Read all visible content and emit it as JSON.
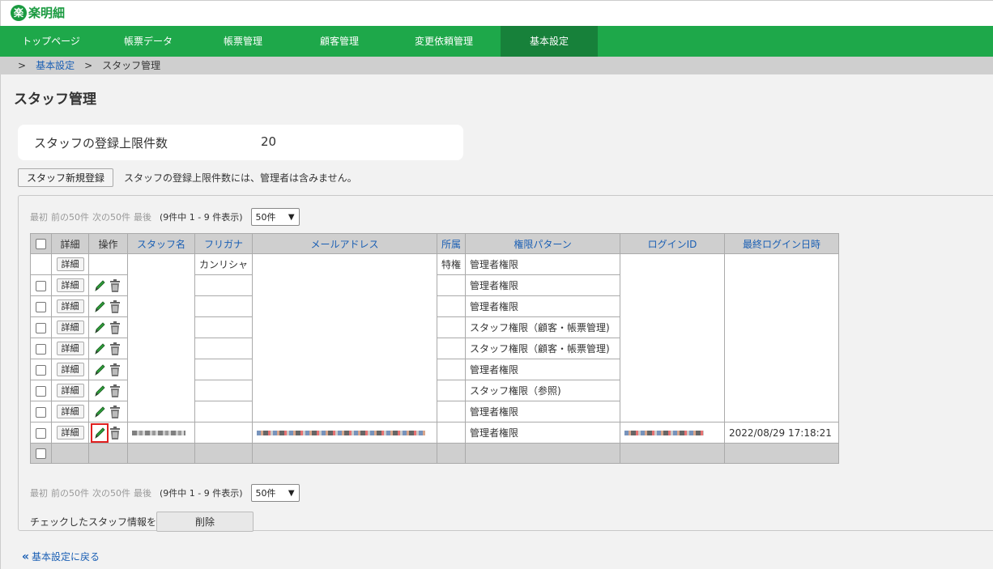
{
  "header": {
    "logo_badge": "楽",
    "logo_text": "楽明細"
  },
  "nav": [
    {
      "label": "トップページ",
      "active": false
    },
    {
      "label": "帳票データ",
      "active": false
    },
    {
      "label": "帳票管理",
      "active": false
    },
    {
      "label": "顧客管理",
      "active": false
    },
    {
      "label": "変更依頼管理",
      "active": false
    },
    {
      "label": "基本設定",
      "active": true
    }
  ],
  "breadcrumb": {
    "sep1": ">",
    "parent": "基本設定",
    "sep2": ">",
    "current": "スタッフ管理"
  },
  "page_title": "スタッフ管理",
  "limit": {
    "label": "スタッフの登録上限件数",
    "value": "20"
  },
  "new_button": "スタッフ新規登録",
  "new_note": "スタッフの登録上限件数には、管理者は含みません。",
  "pager": {
    "first": "最初",
    "prev": "前の50件",
    "next": "次の50件",
    "last": "最後",
    "count": "(9件中 1 - 9 件表示)",
    "per_page": "50件"
  },
  "table": {
    "headers": {
      "detail": "詳細",
      "ops": "操作",
      "name": "スタッフ名",
      "kana": "フリガナ",
      "email": "メールアドレス",
      "dept": "所属",
      "role": "権限パターン",
      "login_id": "ログインID",
      "last_login": "最終ログイン日時"
    },
    "detail_label": "詳細",
    "rows": [
      {
        "kana": "カンリシャ",
        "dept": "特権",
        "role": "管理者権限",
        "last_login": ""
      },
      {
        "kana": "",
        "dept": "",
        "role": "管理者権限",
        "last_login": ""
      },
      {
        "kana": "",
        "dept": "",
        "role": "管理者権限",
        "last_login": ""
      },
      {
        "kana": "",
        "dept": "",
        "role": "スタッフ権限（顧客・帳票管理)",
        "last_login": ""
      },
      {
        "kana": "",
        "dept": "",
        "role": "スタッフ権限（顧客・帳票管理)",
        "last_login": ""
      },
      {
        "kana": "",
        "dept": "",
        "role": "管理者権限",
        "last_login": ""
      },
      {
        "kana": "",
        "dept": "",
        "role": "スタッフ権限（参照)",
        "last_login": ""
      },
      {
        "kana": "",
        "dept": "",
        "role": "管理者権限",
        "last_login": ""
      },
      {
        "kana": "",
        "dept": "",
        "role": "管理者権限",
        "last_login": "2022/08/29 17:18:21"
      }
    ]
  },
  "bulk": {
    "label": "チェックしたスタッフ情報を",
    "button": "削除"
  },
  "back_link": "基本設定に戻る",
  "colors": {
    "nav_bg": "#1ea84a",
    "nav_active": "#17813a",
    "link": "#1a5fb4",
    "highlight": "#e02020"
  }
}
